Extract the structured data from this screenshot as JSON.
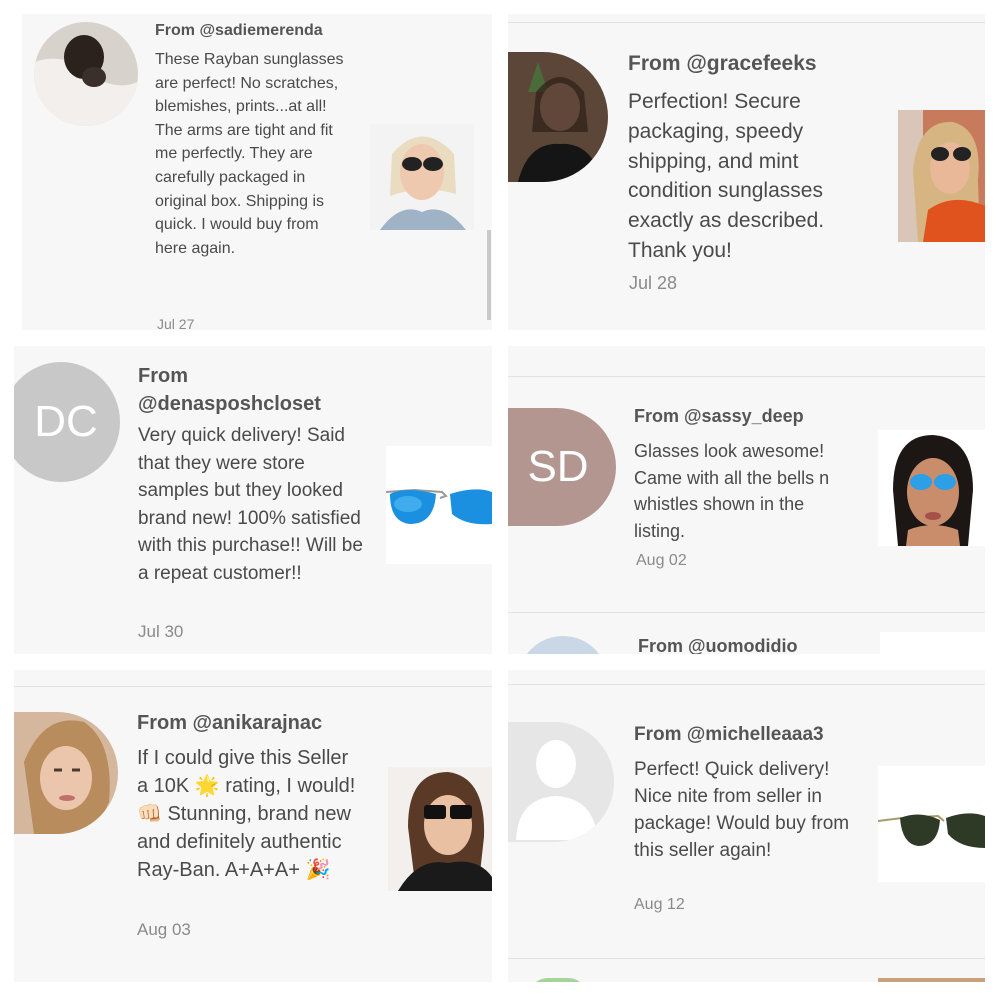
{
  "reviews": [
    {
      "from": "From @sadiemerenda",
      "text": "These Rayban sunglasses are perfect! No scratches, blemishes, prints...at all! The arms are tight and fit me perfectly. They are carefully packaged in original box. Shipping is quick. I would buy from here again.",
      "date": "Jul 27"
    },
    {
      "from": "From @gracefeeks",
      "text": "Perfection! Secure packaging, speedy shipping, and mint condition sunglasses exactly as described. Thank you!",
      "date": "Jul 28"
    },
    {
      "from": "From @denasposhcloset",
      "text": "Very quick delivery! Said that they were store samples but they looked brand new! 100% satisfied with this purchase!! Will be a repeat customer!!",
      "date": "Jul 30",
      "initials": "DC"
    },
    {
      "from": "From @sassy_deep",
      "text": "Glasses look awesome! Came with all the bells n whistles shown in the listing.",
      "date": "Aug 02",
      "initials": "SD"
    },
    {
      "from": "From @uomodidio"
    },
    {
      "from": "From @anikarajnac",
      "text_parts": [
        "If I could give this Seller a 10K ",
        "🌟",
        " rating, I would! ",
        "👊🏻",
        " Stunning, brand new and definitely authentic Ray-Ban. A+A+A+ ",
        "🎉"
      ],
      "date": "Aug 03"
    },
    {
      "from": "From @michelleaaa3",
      "text": "Perfect! Quick delivery! Nice nite from seller in package! Would buy from this seller again!",
      "date": "Aug 12"
    }
  ],
  "colors": {
    "panel_bg": "#f7f7f7",
    "avatar_dc": "#c8c8c8",
    "avatar_sd": "#b49690",
    "placeholder_avatar": "#e6e6e6"
  },
  "icons": {
    "placeholder_avatar": "user-silhouette-icon"
  }
}
